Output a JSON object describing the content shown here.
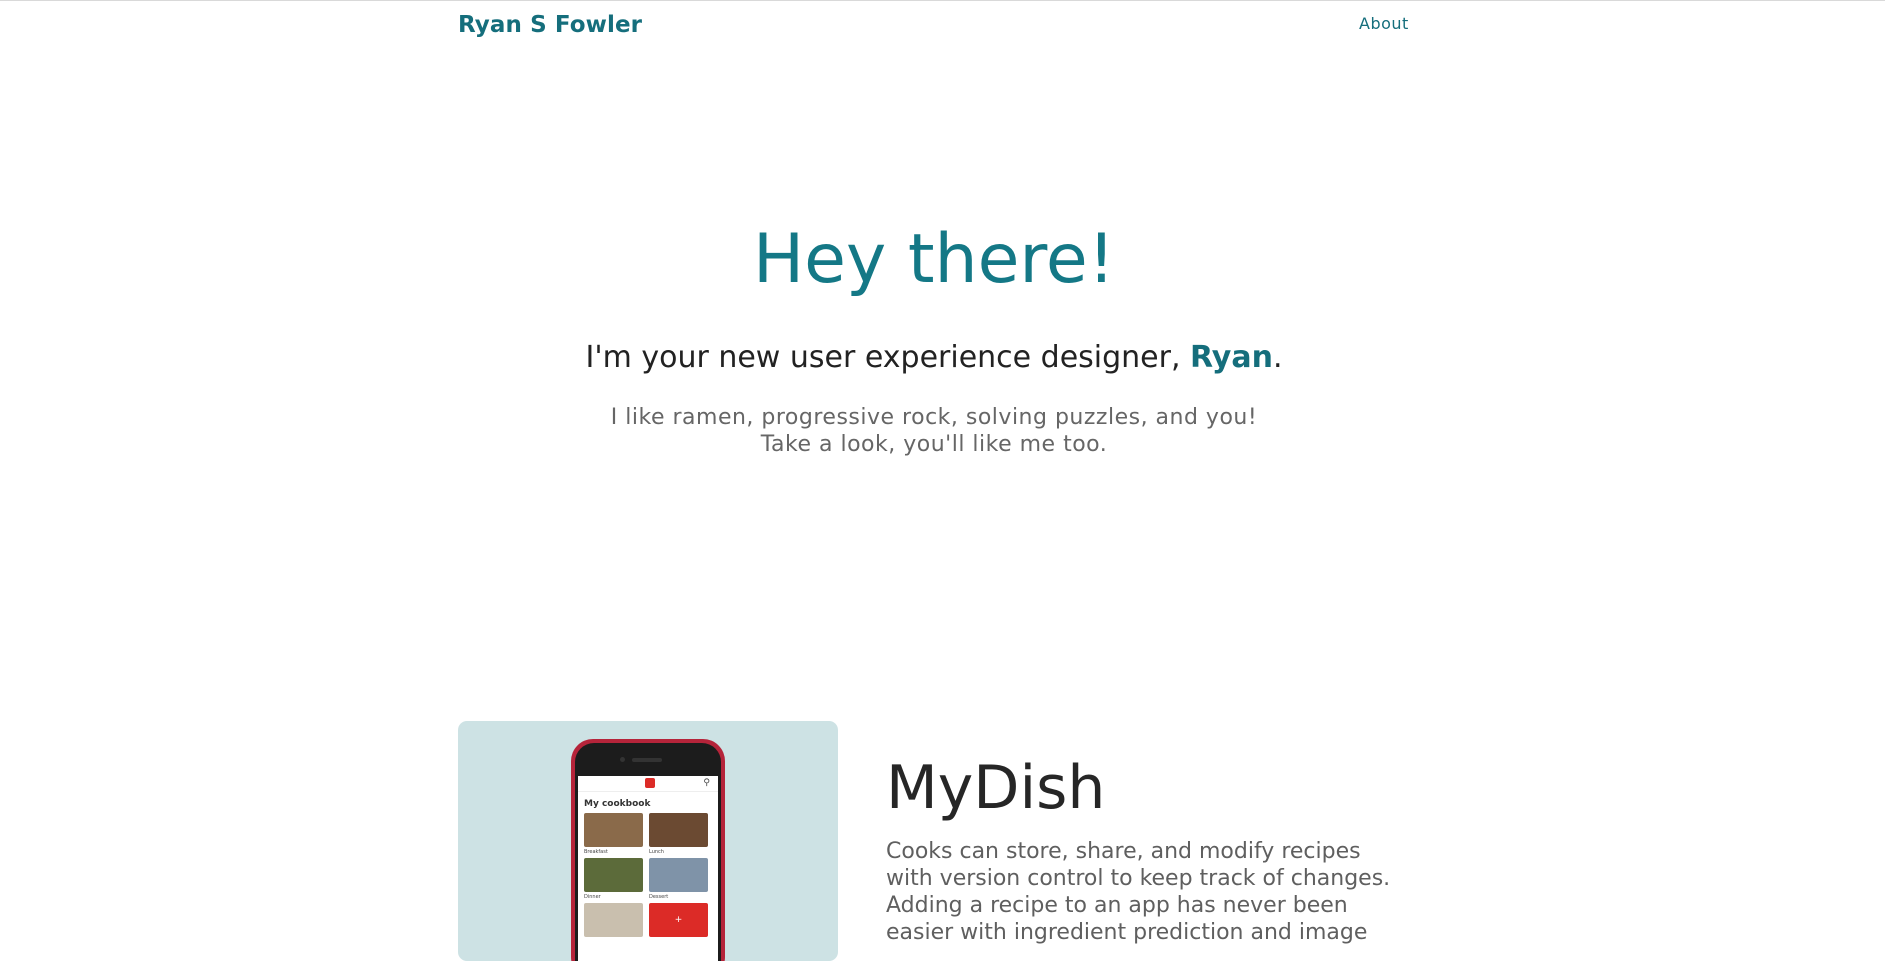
{
  "header": {
    "brand": "Ryan S Fowler",
    "nav": [
      {
        "label": "About"
      }
    ]
  },
  "hero": {
    "title": "Hey there!",
    "subtitle_prefix": "I'm your new user experience designer, ",
    "subtitle_name": "Ryan",
    "subtitle_suffix": ".",
    "line1": "I like ramen, progressive rock, solving puzzles, and you!",
    "line2": "Take a look, you'll like me too."
  },
  "project": {
    "title": "MyDish",
    "description": "Cooks can store, share, and modify recipes with version control to keep track of changes. Adding a recipe to an app has never been easier with ingredient prediction and image",
    "mockup": {
      "heading": "My cookbook",
      "tiles": [
        {
          "label": "Breakfast",
          "color": "#8a6a4a"
        },
        {
          "label": "Lunch",
          "color": "#6b4a32"
        },
        {
          "label": "Dinner",
          "color": "#5c6b3a"
        },
        {
          "label": "Dessert",
          "color": "#7f93a8"
        },
        {
          "label": "",
          "color": "#c9bfae"
        }
      ],
      "add_label": "+"
    }
  },
  "colors": {
    "accent": "#156e7c",
    "card_bg": "#cde2e4",
    "phone": "#b5243a",
    "app_red": "#dc2b27"
  }
}
